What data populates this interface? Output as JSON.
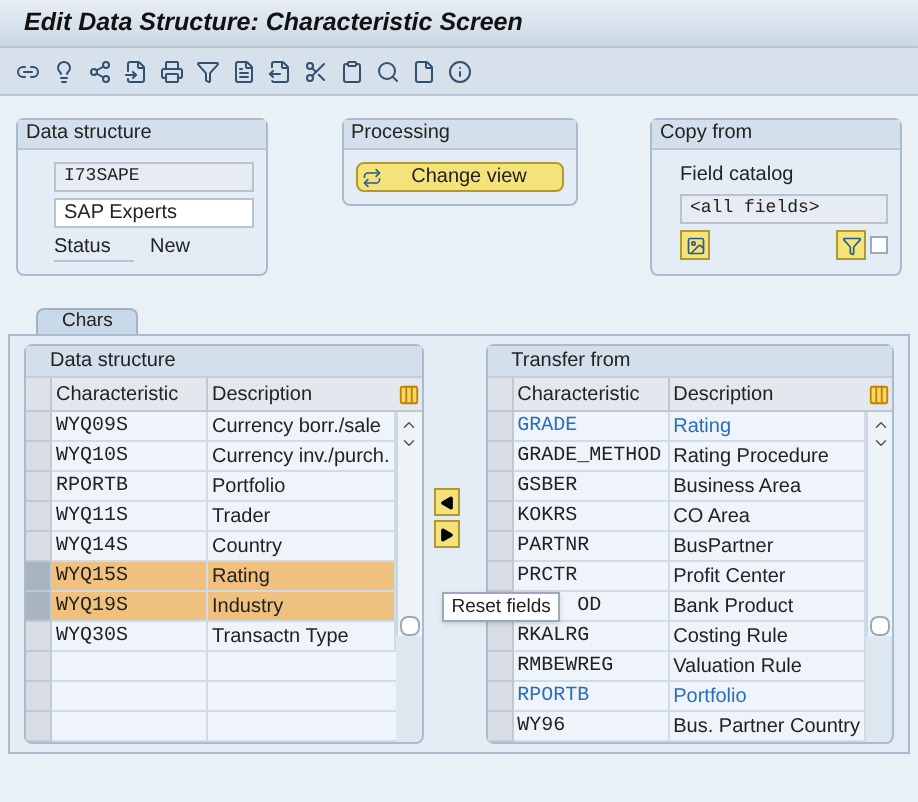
{
  "window": {
    "title": "Edit Data Structure: Characteristic Screen"
  },
  "data_structure": {
    "title": "Data structure",
    "name": "I73SAPE",
    "description": "SAP Experts",
    "status_label": "Status",
    "status": "New"
  },
  "processing": {
    "title": "Processing",
    "button": "Change view"
  },
  "copy_from": {
    "title": "Copy from",
    "label": "Field catalog",
    "value": "<all fields>",
    "checked": false
  },
  "tabs": [
    {
      "label": "Chars",
      "selected": true
    }
  ],
  "left_table": {
    "title": "Data structure",
    "columns": [
      "Characteristic",
      "Description"
    ],
    "rows": [
      {
        "characteristic": "WYQ09S",
        "description": "Currency borr./sale",
        "selected": false
      },
      {
        "characteristic": "WYQ10S",
        "description": "Currency inv./purch.",
        "selected": false
      },
      {
        "characteristic": "RPORTB",
        "description": "Portfolio",
        "selected": false
      },
      {
        "characteristic": "WYQ11S",
        "description": "Trader",
        "selected": false
      },
      {
        "characteristic": "WYQ14S",
        "description": "Country",
        "selected": false
      },
      {
        "characteristic": "WYQ15S",
        "description": "Rating",
        "selected": true
      },
      {
        "characteristic": "WYQ19S",
        "description": "Industry",
        "selected": true
      },
      {
        "characteristic": "WYQ30S",
        "description": "Transactn Type",
        "selected": false
      }
    ]
  },
  "tooltip": "Reset fields",
  "right_table": {
    "title": "Transfer from",
    "columns": [
      "Characteristic",
      "Description"
    ],
    "rows": [
      {
        "characteristic": "GRADE",
        "description": "Rating",
        "assigned": true
      },
      {
        "characteristic": "GRADE_METHOD",
        "description": "Rating Procedure",
        "assigned": false
      },
      {
        "characteristic": "GSBER",
        "description": "Business Area",
        "assigned": false
      },
      {
        "characteristic": "KOKRS",
        "description": "CO Area",
        "assigned": false
      },
      {
        "characteristic": "PARTNR",
        "description": "BusPartner",
        "assigned": false
      },
      {
        "characteristic": "PRCTR",
        "description": "Profit Center",
        "assigned": false
      },
      {
        "characteristic": "OD",
        "description": "Bank Product",
        "assigned": false,
        "kind": "covered"
      },
      {
        "characteristic": "RKALRG",
        "description": "Costing Rule",
        "assigned": false
      },
      {
        "characteristic": "RMBEWREG",
        "description": "Valuation Rule",
        "assigned": false
      },
      {
        "characteristic": "RPORTB",
        "description": "Portfolio",
        "assigned": true
      },
      {
        "characteristic": "WY96",
        "description": "Bus. Partner Country",
        "assigned": false
      }
    ]
  }
}
